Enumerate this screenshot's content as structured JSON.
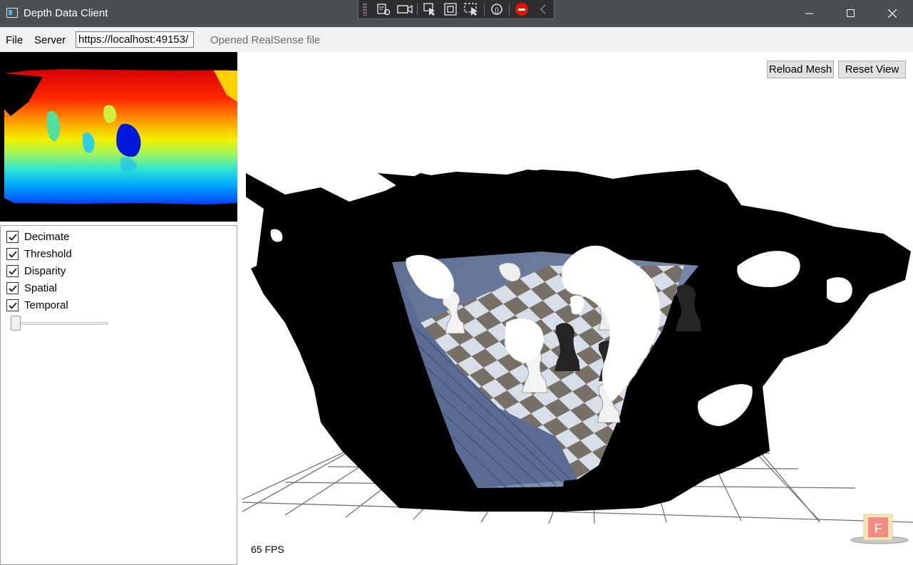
{
  "window": {
    "title": "Depth Data Client"
  },
  "menu": {
    "items": [
      "File",
      "Server"
    ]
  },
  "server": {
    "url_value": "https://localhost:49153/"
  },
  "status": {
    "text": "Opened RealSense file"
  },
  "filters": {
    "items": [
      {
        "label": "Decimate",
        "checked": true
      },
      {
        "label": "Threshold",
        "checked": true
      },
      {
        "label": "Disparity",
        "checked": true
      },
      {
        "label": "Spatial",
        "checked": true
      },
      {
        "label": "Temporal",
        "checked": true
      }
    ],
    "temporal_slider_value": 0
  },
  "viewport": {
    "reload_label": "Reload Mesh",
    "reset_label": "Reset View",
    "fps_text": "65 FPS",
    "badge_letter": "F"
  },
  "colors": {
    "titlebar": "#4a4f53",
    "menubar": "#f0f0f0",
    "stop": "#e51400"
  }
}
